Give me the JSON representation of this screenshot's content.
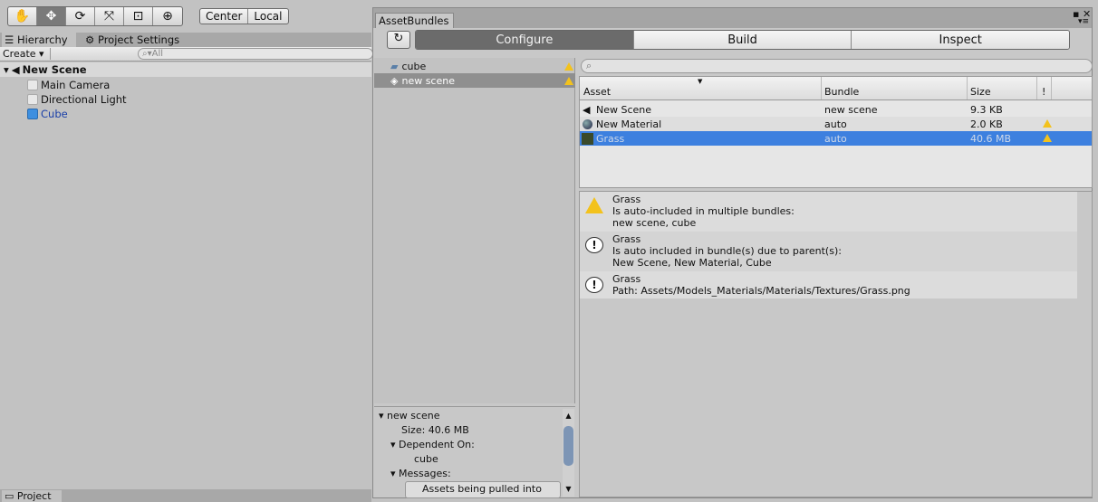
{
  "toolbar": {
    "tools": [
      "hand-icon",
      "move-icon",
      "rotate-icon",
      "scale-icon",
      "rect-icon",
      "transform-icon"
    ],
    "pivot": "Center",
    "space": "Local"
  },
  "left": {
    "tabs": [
      "Hierarchy",
      "Project Settings"
    ],
    "create": "Create",
    "search_placeholder": "All",
    "scene": "New Scene",
    "items": [
      "Main Camera",
      "Directional Light",
      "Cube"
    ],
    "bottom_tab": "Project"
  },
  "window": {
    "title": "AssetBundles",
    "tabs": [
      "Configure",
      "Build",
      "Inspect"
    ],
    "bundles": [
      "cube",
      "new scene"
    ],
    "details": {
      "name": "new scene",
      "size": "Size: 40.6 MB",
      "dep_label": "Dependent On:",
      "dep": "cube",
      "messages_label": "Messages:",
      "message": "Assets being pulled into this"
    },
    "columns": [
      "Asset",
      "Bundle",
      "Size",
      "!"
    ],
    "rows": [
      {
        "asset": "New Scene",
        "bundle": "new scene",
        "size": "9.3 KB",
        "warn": false
      },
      {
        "asset": "New Material",
        "bundle": "auto",
        "size": "2.0 KB",
        "warn": true
      },
      {
        "asset": "Grass",
        "bundle": "auto",
        "size": "40.6 MB",
        "warn": true
      }
    ],
    "messages": [
      {
        "type": "warning",
        "title": "Grass",
        "l1": "Is auto-included in multiple bundles:",
        "l2": "new scene, cube"
      },
      {
        "type": "info",
        "title": "Grass",
        "l1": "Is auto included in bundle(s) due to parent(s):",
        "l2": "New Scene, New Material, Cube"
      },
      {
        "type": "info",
        "title": "Grass",
        "l1": "Path: Assets/Models_Materials/Materials/Textures/Grass.png",
        "l2": ""
      }
    ]
  },
  "colors": {
    "selection": "#3d80df",
    "segment_selected": "#6b6b6b"
  }
}
